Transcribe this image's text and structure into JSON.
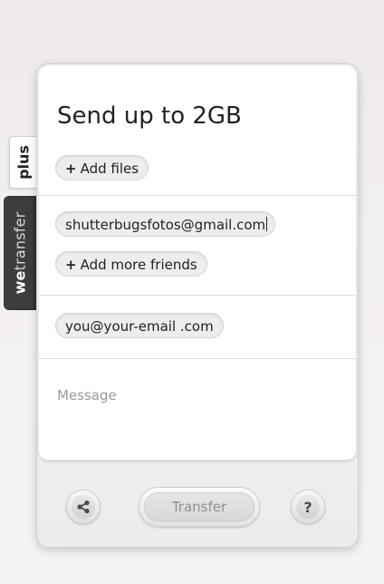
{
  "side_tabs": {
    "plus_label": "plus",
    "brand_bold": "we",
    "brand_rest": "transfer"
  },
  "form": {
    "title": "Send up to 2GB",
    "add_files_label": "Add files",
    "add_files_prefix": "+",
    "recipient_email": "shutterbugsfotos@gmail.com",
    "add_friends_label": "Add more friends",
    "add_friends_prefix": "+",
    "sender_email": "you@your-email .com",
    "message_placeholder": "Message"
  },
  "footer": {
    "transfer_label": "Transfer",
    "help_label": "?"
  },
  "colors": {
    "background": "#f3f0f0",
    "brand_tab": "#3d3d3d",
    "text": "#222222",
    "placeholder": "#9a9a9a"
  },
  "icons": {
    "share": "share-icon",
    "help": "help-icon"
  }
}
